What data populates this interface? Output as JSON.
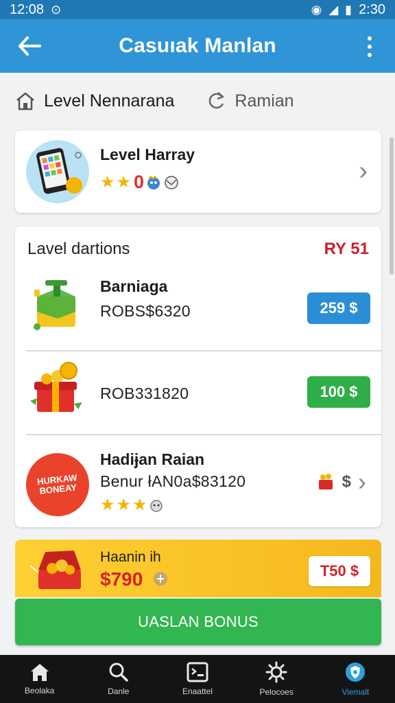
{
  "status_bar": {
    "time": "12:08",
    "battery_time": "2:30"
  },
  "app_bar": {
    "title": "Casuıak Manlan"
  },
  "tabs": [
    {
      "label": "Level Nennarana",
      "icon": "home-icon"
    },
    {
      "label": "Ramian",
      "icon": "refresh-icon"
    }
  ],
  "level_card": {
    "title": "Level Harray",
    "stars": 2,
    "badge": "0"
  },
  "list": {
    "title": "Lavel dartions",
    "right_label": "RY 51",
    "rows": [
      {
        "name": "Barniaga",
        "code": "ROBS$6320",
        "price": "259 $"
      },
      {
        "name": "",
        "code": "ROB331820",
        "price": "100 $"
      },
      {
        "name": "Hadiɉan Raian",
        "code": "Benur łAN0a$83120",
        "badge_line1": "HURKAW",
        "badge_line2": "BONEAY",
        "stars": 3,
        "right_symbol": "$"
      }
    ]
  },
  "promo": {
    "title": "Haanin ih",
    "price": "$790",
    "pill": "T50 $"
  },
  "cta": {
    "label": "UASLAN BONUS"
  },
  "bottom_nav": [
    {
      "label": "Beolaka",
      "icon": "home-icon"
    },
    {
      "label": "Danle",
      "icon": "search-icon"
    },
    {
      "label": "Enaattel",
      "icon": "card-icon"
    },
    {
      "label": "Pelocoes",
      "icon": "gear-icon"
    },
    {
      "label": "Viemalt",
      "icon": "shield-icon",
      "active": true
    }
  ],
  "colors": {
    "app_bar": "#2f95d7",
    "status_bar": "#1f78b4",
    "accent_red": "#d6222a",
    "pill_blue": "#2a8fd6",
    "pill_green": "#2fae4a",
    "cta_green": "#32b651",
    "promo_yellow": "#ffd033",
    "star": "#f5b400"
  }
}
